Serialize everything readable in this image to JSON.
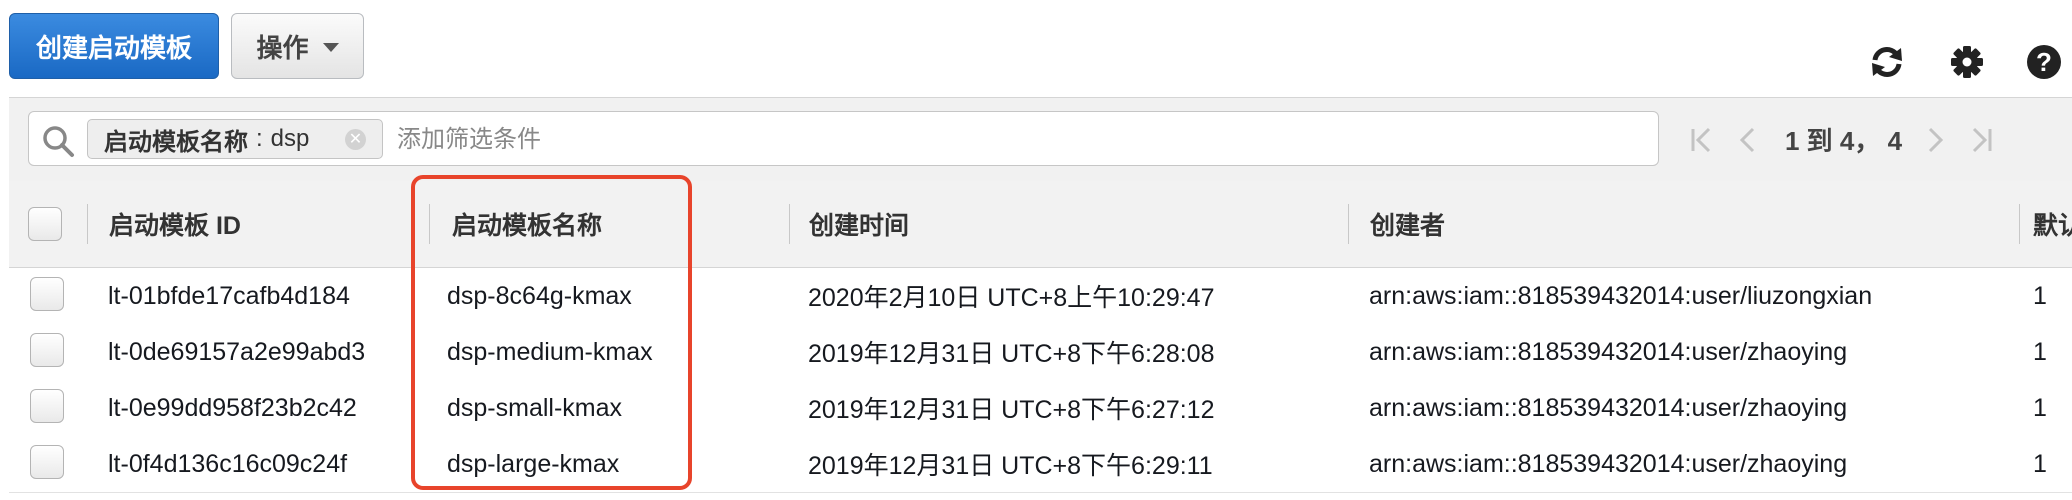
{
  "toolbar": {
    "create_button": "创建启动模板",
    "actions_button": "操作",
    "icons": [
      "refresh-icon",
      "settings-gear-icon",
      "help-icon"
    ]
  },
  "filter": {
    "token_key": "启动模板名称",
    "token_sep": ":",
    "token_value": "dsp",
    "placeholder": "添加筛选条件"
  },
  "pagination": {
    "text": "1 到 4， 4"
  },
  "table": {
    "columns": [
      "启动模板 ID",
      "启动模板名称",
      "创建时间",
      "创建者",
      "默认"
    ],
    "rows": [
      {
        "id": "lt-01bfde17cafb4d184",
        "name": "dsp-8c64g-kmax",
        "created": "2020年2月10日 UTC+8上午10:29:47",
        "creator": "arn:aws:iam::818539432014:user/liuzongxian",
        "default": "1"
      },
      {
        "id": "lt-0de69157a2e99abd3",
        "name": "dsp-medium-kmax",
        "created": "2019年12月31日 UTC+8下午6:28:08",
        "creator": "arn:aws:iam::818539432014:user/zhaoying",
        "default": "1"
      },
      {
        "id": "lt-0e99dd958f23b2c42",
        "name": "dsp-small-kmax",
        "created": "2019年12月31日 UTC+8下午6:27:12",
        "creator": "arn:aws:iam::818539432014:user/zhaoying",
        "default": "1"
      },
      {
        "id": "lt-0f4d136c16c09c24f",
        "name": "dsp-large-kmax",
        "created": "2019年12月31日 UTC+8下午6:29:11",
        "creator": "arn:aws:iam::818539432014:user/zhaoying",
        "default": "1"
      }
    ]
  },
  "colors": {
    "primary": "#1a69c4",
    "highlight": "#e8442b"
  }
}
